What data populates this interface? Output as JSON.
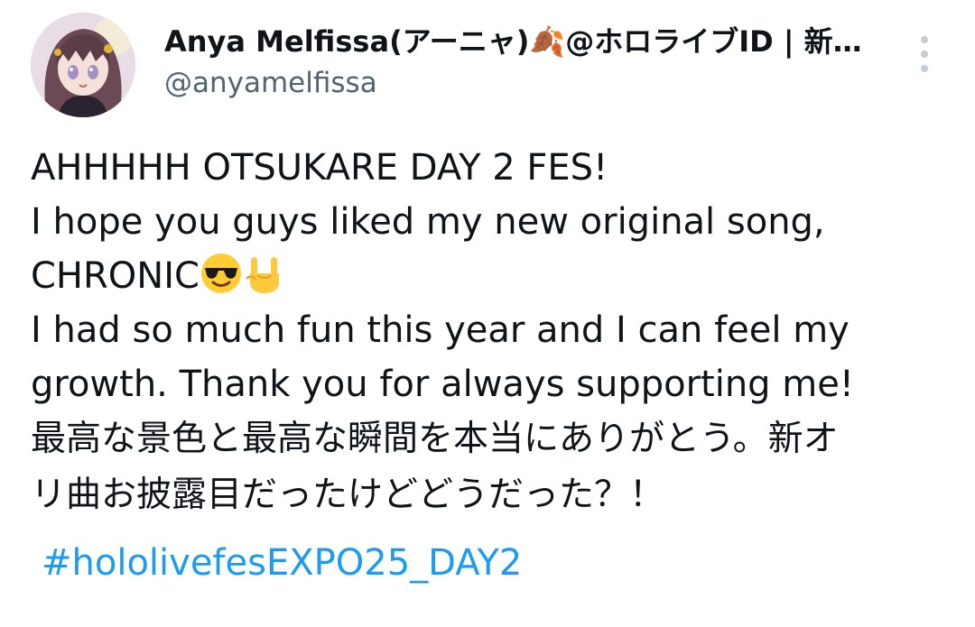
{
  "header": {
    "display_name": "Anya Melfissa(アーニャ)🍂@ホロライブID | 新…",
    "handle": "@anyamelfissa"
  },
  "icons": {
    "avatar": "avatar-image",
    "more": "more-vertical-icon",
    "sunglasses_emoji": "smiling-face-with-sunglasses-emoji",
    "rock_emoji": "sign-of-the-horns-emoji"
  },
  "tweet": {
    "line1": "AHHHHH OTSUKARE DAY 2 FES!",
    "line2": "I hope you guys liked my new original song,",
    "line3_text": "CHRONIC",
    "line4": "I had so much fun this year and I can feel my",
    "line5": "growth. Thank you for always supporting me!",
    "line6": "最高な景色と最高な瞬間を本当にありがとう。新オ",
    "line7": "リ曲お披露目だったけどどうだった？！",
    "hashtag": "#hololivefesEXPO25_DAY2"
  },
  "colors": {
    "text": "#0f1419",
    "secondary": "#536471",
    "link": "#1d9bf0"
  }
}
